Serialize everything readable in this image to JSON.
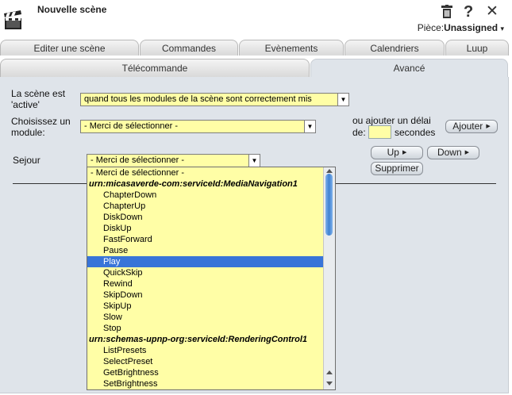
{
  "header": {
    "title": "Nouvelle scène",
    "trash_icon": "trash-icon",
    "help_label": "?",
    "close_label": "✕",
    "room_label": "Pièce:",
    "room_value": "Unassigned",
    "room_arrow": "▾"
  },
  "tabs_top": [
    "Editer une scène",
    "Commandes",
    "Evènements",
    "Calendriers",
    "Luup"
  ],
  "tabs_sub": [
    "Télécommande",
    "Avancé"
  ],
  "form": {
    "active_label": "La scène est 'active'",
    "active_value": "quand tous les modules de la scène sont correctement mis",
    "module_label": "Choisissez un module:",
    "module_value": "- Merci de sélectionner -",
    "delay_label_line1": "ou ajouter un délai",
    "delay_label_de": "de:",
    "delay_value": "",
    "delay_unit": "secondes",
    "add_button": "Ajouter",
    "device_name": "Sejour",
    "device_select_value": "- Merci de sélectionner -",
    "up_button": "Up",
    "down_button": "Down",
    "delete_button": "Supprimer"
  },
  "dropdown": {
    "selected": "Play",
    "items": [
      {
        "label": "- Merci de sélectionner -",
        "kind": "first"
      },
      {
        "label": "urn:micasaverde-com:serviceId:MediaNavigation1",
        "kind": "group"
      },
      {
        "label": "ChapterDown",
        "kind": "item"
      },
      {
        "label": "ChapterUp",
        "kind": "item"
      },
      {
        "label": "DiskDown",
        "kind": "item"
      },
      {
        "label": "DiskUp",
        "kind": "item"
      },
      {
        "label": "FastForward",
        "kind": "item"
      },
      {
        "label": "Pause",
        "kind": "item"
      },
      {
        "label": "Play",
        "kind": "item"
      },
      {
        "label": "QuickSkip",
        "kind": "item"
      },
      {
        "label": "Rewind",
        "kind": "item"
      },
      {
        "label": "SkipDown",
        "kind": "item"
      },
      {
        "label": "SkipUp",
        "kind": "item"
      },
      {
        "label": "Slow",
        "kind": "item"
      },
      {
        "label": "Stop",
        "kind": "item"
      },
      {
        "label": "urn:schemas-upnp-org:serviceId:RenderingControl1",
        "kind": "group"
      },
      {
        "label": "ListPresets",
        "kind": "item"
      },
      {
        "label": "SelectPreset",
        "kind": "item"
      },
      {
        "label": "GetBrightness",
        "kind": "item"
      },
      {
        "label": "SetBrightness",
        "kind": "item"
      }
    ]
  }
}
